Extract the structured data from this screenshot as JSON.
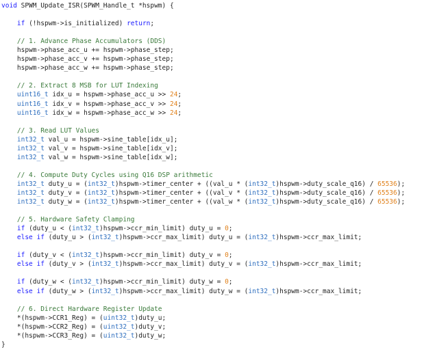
{
  "editor": {
    "theme": {
      "background": "#ffffff",
      "text": "#1f1f1f",
      "keyword": "#1a1aff",
      "type": "#2f6fbf",
      "comment": "#3a7a3a",
      "number": "#e0801a"
    },
    "lines": [
      [
        {
          "k": "kw",
          "t": "void"
        },
        {
          "k": "tx",
          "t": " SPWM_Update_ISR(SPWM_Handle_t *hspwm) {"
        }
      ],
      [],
      [
        {
          "k": "tx",
          "t": "    "
        },
        {
          "k": "kw",
          "t": "if"
        },
        {
          "k": "tx",
          "t": " (!hspwm->is_initialized) "
        },
        {
          "k": "kw",
          "t": "return"
        },
        {
          "k": "tx",
          "t": ";"
        }
      ],
      [],
      [
        {
          "k": "tx",
          "t": "    "
        },
        {
          "k": "cm",
          "t": "// 1. Advance Phase Accumulators (DDS)"
        }
      ],
      [
        {
          "k": "tx",
          "t": "    hspwm->phase_acc_u += hspwm->phase_step;"
        }
      ],
      [
        {
          "k": "tx",
          "t": "    hspwm->phase_acc_v += hspwm->phase_step;"
        }
      ],
      [
        {
          "k": "tx",
          "t": "    hspwm->phase_acc_w += hspwm->phase_step;"
        }
      ],
      [],
      [
        {
          "k": "tx",
          "t": "    "
        },
        {
          "k": "cm",
          "t": "// 2. Extract 8 MSB for LUT Indexing"
        }
      ],
      [
        {
          "k": "tx",
          "t": "    "
        },
        {
          "k": "type",
          "t": "uint16_t"
        },
        {
          "k": "tx",
          "t": " idx_u = hspwm->phase_acc_u >> "
        },
        {
          "k": "num",
          "t": "24"
        },
        {
          "k": "tx",
          "t": ";"
        }
      ],
      [
        {
          "k": "tx",
          "t": "    "
        },
        {
          "k": "type",
          "t": "uint16_t"
        },
        {
          "k": "tx",
          "t": " idx_v = hspwm->phase_acc_v >> "
        },
        {
          "k": "num",
          "t": "24"
        },
        {
          "k": "tx",
          "t": ";"
        }
      ],
      [
        {
          "k": "tx",
          "t": "    "
        },
        {
          "k": "type",
          "t": "uint16_t"
        },
        {
          "k": "tx",
          "t": " idx_w = hspwm->phase_acc_w >> "
        },
        {
          "k": "num",
          "t": "24"
        },
        {
          "k": "tx",
          "t": ";"
        }
      ],
      [],
      [
        {
          "k": "tx",
          "t": "    "
        },
        {
          "k": "cm",
          "t": "// 3. Read LUT Values"
        }
      ],
      [
        {
          "k": "tx",
          "t": "    "
        },
        {
          "k": "type",
          "t": "int32_t"
        },
        {
          "k": "tx",
          "t": " val_u = hspwm->sine_table[idx_u];"
        }
      ],
      [
        {
          "k": "tx",
          "t": "    "
        },
        {
          "k": "type",
          "t": "int32_t"
        },
        {
          "k": "tx",
          "t": " val_v = hspwm->sine_table[idx_v];"
        }
      ],
      [
        {
          "k": "tx",
          "t": "    "
        },
        {
          "k": "type",
          "t": "int32_t"
        },
        {
          "k": "tx",
          "t": " val_w = hspwm->sine_table[idx_w];"
        }
      ],
      [],
      [
        {
          "k": "tx",
          "t": "    "
        },
        {
          "k": "cm",
          "t": "// 4. Compute Duty Cycles using Q16 DSP arithmetic"
        }
      ],
      [
        {
          "k": "tx",
          "t": "    "
        },
        {
          "k": "type",
          "t": "int32_t"
        },
        {
          "k": "tx",
          "t": " duty_u = ("
        },
        {
          "k": "type",
          "t": "int32_t"
        },
        {
          "k": "tx",
          "t": ")hspwm->timer_center + ((val_u * ("
        },
        {
          "k": "type",
          "t": "int32_t"
        },
        {
          "k": "tx",
          "t": ")hspwm->duty_scale_q16) / "
        },
        {
          "k": "num",
          "t": "65536"
        },
        {
          "k": "tx",
          "t": ");"
        }
      ],
      [
        {
          "k": "tx",
          "t": "    "
        },
        {
          "k": "type",
          "t": "int32_t"
        },
        {
          "k": "tx",
          "t": " duty_v = ("
        },
        {
          "k": "type",
          "t": "int32_t"
        },
        {
          "k": "tx",
          "t": ")hspwm->timer_center + ((val_v * ("
        },
        {
          "k": "type",
          "t": "int32_t"
        },
        {
          "k": "tx",
          "t": ")hspwm->duty_scale_q16) / "
        },
        {
          "k": "num",
          "t": "65536"
        },
        {
          "k": "tx",
          "t": ");"
        }
      ],
      [
        {
          "k": "tx",
          "t": "    "
        },
        {
          "k": "type",
          "t": "int32_t"
        },
        {
          "k": "tx",
          "t": " duty_w = ("
        },
        {
          "k": "type",
          "t": "int32_t"
        },
        {
          "k": "tx",
          "t": ")hspwm->timer_center + ((val_w * ("
        },
        {
          "k": "type",
          "t": "int32_t"
        },
        {
          "k": "tx",
          "t": ")hspwm->duty_scale_q16) / "
        },
        {
          "k": "num",
          "t": "65536"
        },
        {
          "k": "tx",
          "t": ");"
        }
      ],
      [],
      [
        {
          "k": "tx",
          "t": "    "
        },
        {
          "k": "cm",
          "t": "// 5. Hardware Safety Clamping"
        }
      ],
      [
        {
          "k": "tx",
          "t": "    "
        },
        {
          "k": "kw",
          "t": "if"
        },
        {
          "k": "tx",
          "t": " (duty_u < ("
        },
        {
          "k": "type",
          "t": "int32_t"
        },
        {
          "k": "tx",
          "t": ")hspwm->ccr_min_limit) duty_u = "
        },
        {
          "k": "num",
          "t": "0"
        },
        {
          "k": "tx",
          "t": ";"
        }
      ],
      [
        {
          "k": "tx",
          "t": "    "
        },
        {
          "k": "kw",
          "t": "else if"
        },
        {
          "k": "tx",
          "t": " (duty_u > ("
        },
        {
          "k": "type",
          "t": "int32_t"
        },
        {
          "k": "tx",
          "t": ")hspwm->ccr_max_limit) duty_u = ("
        },
        {
          "k": "type",
          "t": "int32_t"
        },
        {
          "k": "tx",
          "t": ")hspwm->ccr_max_limit;"
        }
      ],
      [],
      [
        {
          "k": "tx",
          "t": "    "
        },
        {
          "k": "kw",
          "t": "if"
        },
        {
          "k": "tx",
          "t": " (duty_v < ("
        },
        {
          "k": "type",
          "t": "int32_t"
        },
        {
          "k": "tx",
          "t": ")hspwm->ccr_min_limit) duty_v = "
        },
        {
          "k": "num",
          "t": "0"
        },
        {
          "k": "tx",
          "t": ";"
        }
      ],
      [
        {
          "k": "tx",
          "t": "    "
        },
        {
          "k": "kw",
          "t": "else if"
        },
        {
          "k": "tx",
          "t": " (duty_v > ("
        },
        {
          "k": "type",
          "t": "int32_t"
        },
        {
          "k": "tx",
          "t": ")hspwm->ccr_max_limit) duty_v = ("
        },
        {
          "k": "type",
          "t": "int32_t"
        },
        {
          "k": "tx",
          "t": ")hspwm->ccr_max_limit;"
        }
      ],
      [],
      [
        {
          "k": "tx",
          "t": "    "
        },
        {
          "k": "kw",
          "t": "if"
        },
        {
          "k": "tx",
          "t": " (duty_w < ("
        },
        {
          "k": "type",
          "t": "int32_t"
        },
        {
          "k": "tx",
          "t": ")hspwm->ccr_min_limit) duty_w = "
        },
        {
          "k": "num",
          "t": "0"
        },
        {
          "k": "tx",
          "t": ";"
        }
      ],
      [
        {
          "k": "tx",
          "t": "    "
        },
        {
          "k": "kw",
          "t": "else if"
        },
        {
          "k": "tx",
          "t": " (duty_w > ("
        },
        {
          "k": "type",
          "t": "int32_t"
        },
        {
          "k": "tx",
          "t": ")hspwm->ccr_max_limit) duty_w = ("
        },
        {
          "k": "type",
          "t": "int32_t"
        },
        {
          "k": "tx",
          "t": ")hspwm->ccr_max_limit;"
        }
      ],
      [],
      [
        {
          "k": "tx",
          "t": "    "
        },
        {
          "k": "cm",
          "t": "// 6. Direct Hardware Register Update"
        }
      ],
      [
        {
          "k": "tx",
          "t": "    *(hspwm->CCR1_Reg) = ("
        },
        {
          "k": "type",
          "t": "uint32_t"
        },
        {
          "k": "tx",
          "t": ")duty_u;"
        }
      ],
      [
        {
          "k": "tx",
          "t": "    *(hspwm->CCR2_Reg) = ("
        },
        {
          "k": "type",
          "t": "uint32_t"
        },
        {
          "k": "tx",
          "t": ")duty_v;"
        }
      ],
      [
        {
          "k": "tx",
          "t": "    *(hspwm->CCR3_Reg) = ("
        },
        {
          "k": "type",
          "t": "uint32_t"
        },
        {
          "k": "tx",
          "t": ")duty_w;"
        }
      ],
      [
        {
          "k": "tx",
          "t": "}"
        }
      ]
    ]
  }
}
